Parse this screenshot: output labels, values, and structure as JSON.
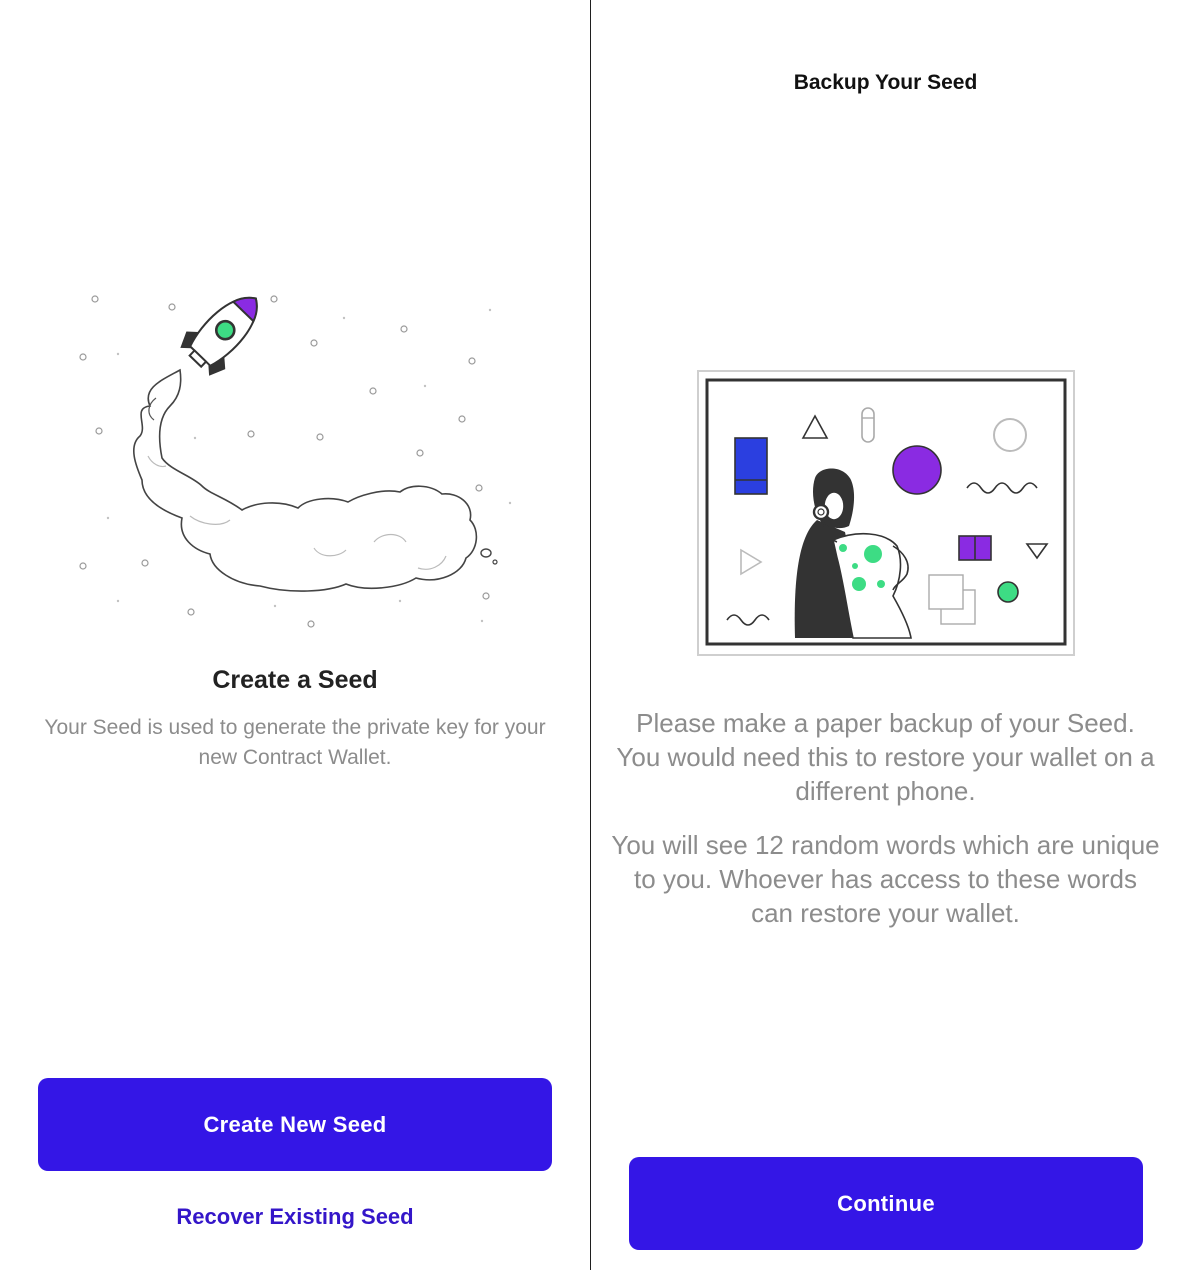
{
  "left": {
    "illustration": "rocket-launch-illustration",
    "heading": "Create a Seed",
    "description": "Your Seed is used to generate the private key for your new Contract Wallet.",
    "primary_button": "Create New Seed",
    "link_button": "Recover Existing Seed"
  },
  "right": {
    "title": "Backup Your Seed",
    "illustration": "paper-backup-illustration",
    "description_1": "Please make a paper backup of your Seed. You would need this to restore your wallet on a different phone.",
    "description_2": "You will see 12 random words which are unique to you. Whoever has access to these words can restore your wallet.",
    "primary_button": "Continue"
  },
  "colors": {
    "accent": "#3416e6",
    "link": "#3416c9",
    "body_text": "#8c8c8c",
    "illustration_green": "#3ddc84",
    "illustration_purple": "#8a2be2",
    "illustration_blue": "#2b3fe0"
  }
}
